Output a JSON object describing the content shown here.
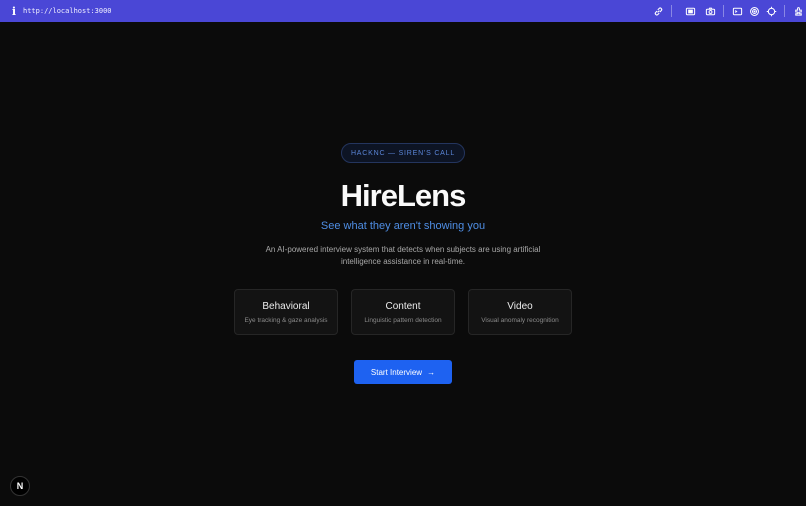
{
  "browser": {
    "info_glyph": "i",
    "url": "http://localhost:3000",
    "toolbar_icons": [
      "link-icon",
      "screenshot-icon",
      "camera-icon",
      "terminal-icon",
      "target-icon",
      "crosshair-icon",
      "extension-icon",
      "panel-icon"
    ]
  },
  "hero": {
    "badge": "HACKNC — SIREN'S CALL",
    "title": "HireLens",
    "subtitle": "See what they aren't showing you",
    "description": "An AI-powered interview system that detects when subjects are using artificial intelligence assistance in real-time."
  },
  "cards": [
    {
      "title": "Behavioral",
      "subtitle": "Eye tracking & gaze analysis"
    },
    {
      "title": "Content",
      "subtitle": "Linguistic pattern detection"
    },
    {
      "title": "Video",
      "subtitle": "Visual anomaly recognition"
    }
  ],
  "cta": {
    "label": "Start Interview",
    "arrow": "→"
  },
  "nextjs_badge": "N",
  "colors": {
    "topbar": "#4a47d6",
    "background": "#0b0b0b",
    "accent": "#4f8ee4",
    "button": "#1e62f1"
  }
}
